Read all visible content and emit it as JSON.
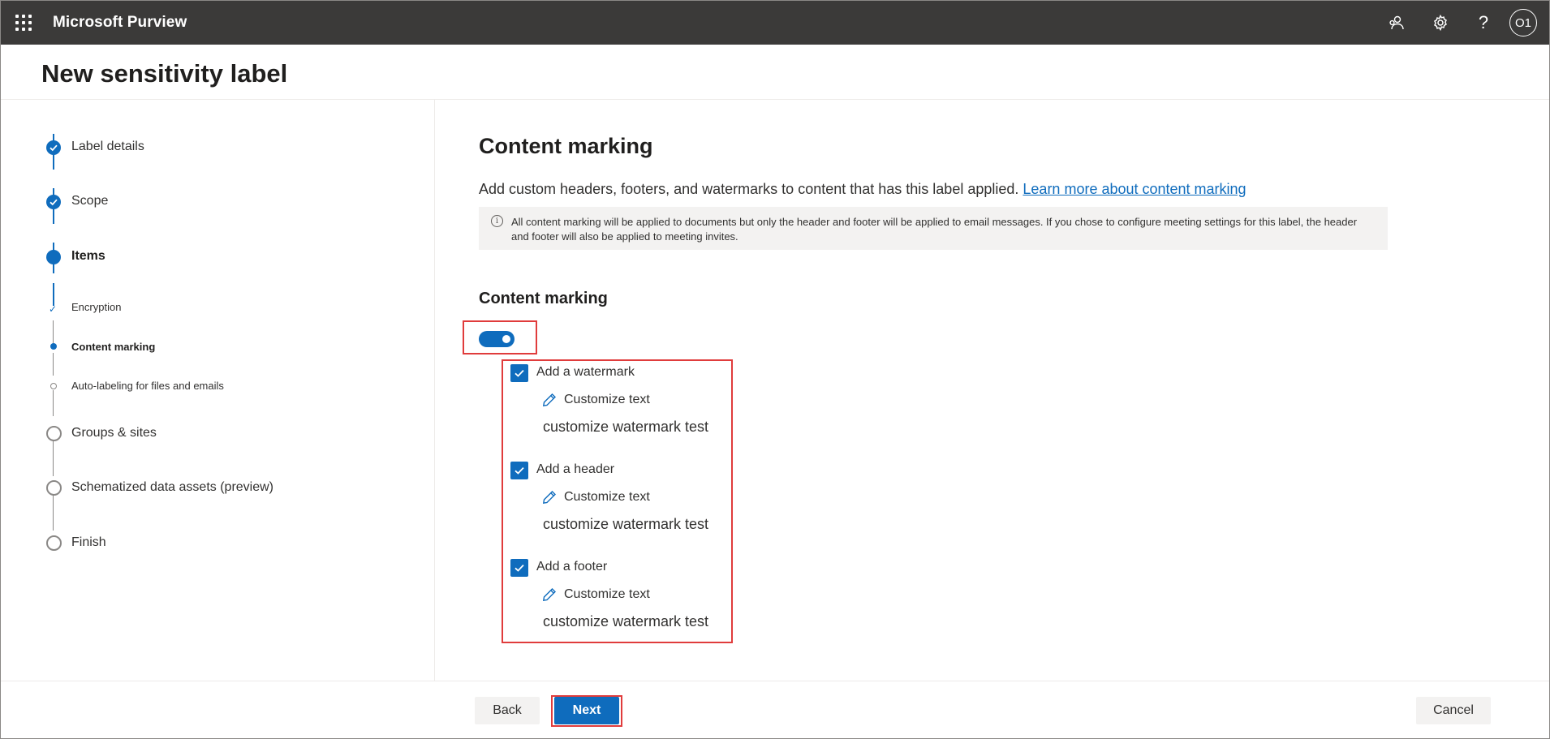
{
  "topbar": {
    "app_name": "Microsoft Purview",
    "icons": [
      "waffle-icon",
      "people-icon",
      "gear-icon",
      "help-icon"
    ],
    "avatar_initials": "O1"
  },
  "page": {
    "title": "New sensitivity label"
  },
  "steps": [
    {
      "label": "Label details",
      "state": "done"
    },
    {
      "label": "Scope",
      "state": "done"
    },
    {
      "label": "Items",
      "state": "current"
    },
    {
      "label": "Encryption",
      "state": "sub-done"
    },
    {
      "label": "Content marking",
      "state": "sub-current"
    },
    {
      "label": "Auto-labeling for files and emails",
      "state": "sub-pending"
    },
    {
      "label": "Groups & sites",
      "state": "pending"
    },
    {
      "label": "Schematized data assets (preview)",
      "state": "pending"
    },
    {
      "label": "Finish",
      "state": "pending"
    }
  ],
  "content": {
    "heading": "Content marking",
    "description": "Add custom headers, footers, and watermarks to content that has this label applied.",
    "learn_more_link": "Learn more about content marking",
    "info_text": "All content marking will be applied to documents but only the header and footer will be applied to email messages. If you chose to configure meeting settings for this label, the header and footer will also be applied to meeting invites.",
    "subheading": "Content marking",
    "toggle_on": true,
    "options": [
      {
        "label": "Add a watermark",
        "checked": true,
        "customize_label": "Customize text",
        "value": "customize watermark test"
      },
      {
        "label": "Add a header",
        "checked": true,
        "customize_label": "Customize text",
        "value": "customize watermark test"
      },
      {
        "label": "Add a footer",
        "checked": true,
        "customize_label": "Customize text",
        "value": "customize watermark test"
      }
    ]
  },
  "footer": {
    "back_label": "Back",
    "next_label": "Next",
    "cancel_label": "Cancel"
  },
  "colors": {
    "accent": "#0f6cbd",
    "topbar": "#3b3a39",
    "highlight_box": "#e03c3c"
  }
}
